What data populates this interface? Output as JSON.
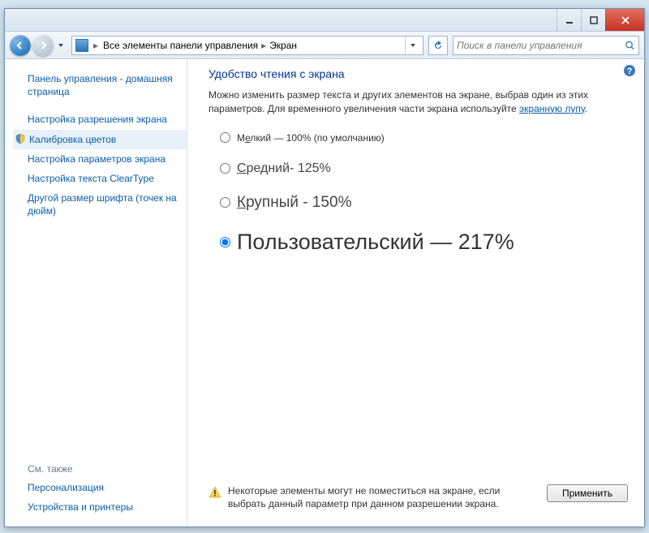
{
  "breadcrumb": {
    "item1": "Все элементы панели управления",
    "item2": "Экран"
  },
  "search": {
    "placeholder": "Поиск в панели управления"
  },
  "sidebar": {
    "home": "Панель управления - домашняя страница",
    "links": [
      "Настройка разрешения экрана",
      "Калибровка цветов",
      "Настройка параметров экрана",
      "Настройка текста ClearType",
      "Другой размер шрифта (точек на дюйм)"
    ],
    "see_also_label": "См. также",
    "see_also": [
      "Персонализация",
      "Устройства и принтеры"
    ]
  },
  "main": {
    "title": "Удобство чтения с экрана",
    "desc_pre": "Можно изменить размер текста и других элементов на экране, выбрав один из этих параметров. Для временного увеличения части экрана используйте ",
    "desc_link": "экранную лупу",
    "desc_post": ".",
    "options": {
      "small_pre": "М",
      "small_u": "е",
      "small_post": "лкий — 100% (по умолчанию)",
      "medium_pre": "",
      "medium_u": "С",
      "medium_post": "редний- 125%",
      "large_pre": "",
      "large_u": "К",
      "large_post": "рупный - 150%",
      "custom": "Пользовательский — 217%"
    },
    "warning": "Некоторые элементы могут не поместиться на экране, если выбрать данный параметр при данном разрешении экрана.",
    "apply": "Применить"
  }
}
